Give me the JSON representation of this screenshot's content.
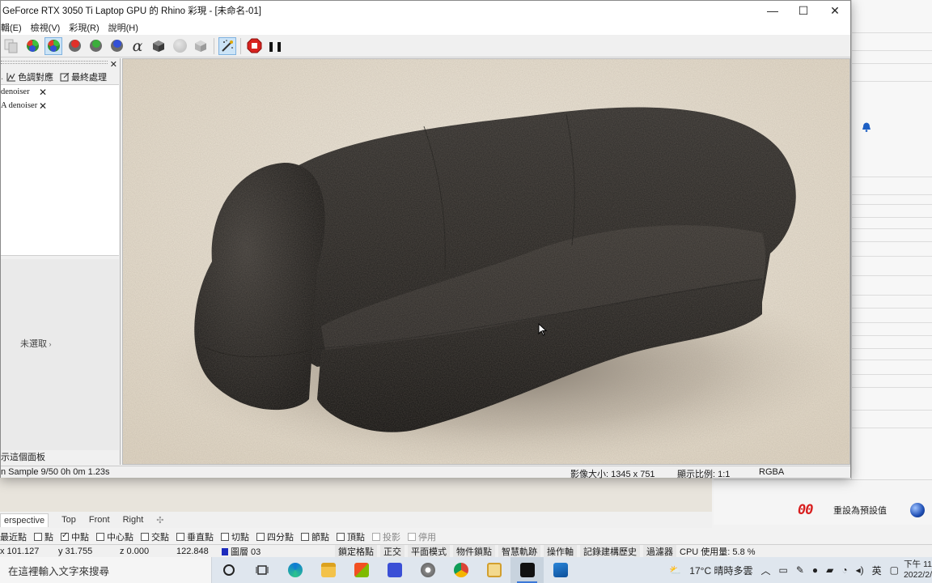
{
  "window": {
    "title": "GeForce RTX 3050 Ti Laptop GPU 的 Rhino 彩現 - [未命名-01]",
    "minimize": "—",
    "maximize": "☐",
    "close": "✕"
  },
  "menu": [
    "輯(E)",
    "檢視(V)",
    "彩現(R)",
    "說明(H)"
  ],
  "toolbar": {
    "icons": [
      "copy-icon",
      "render-channels-icon",
      "render-channels-selected-icon",
      "red-channel-icon",
      "green-channel-icon",
      "blue-channel-icon",
      "alpha-icon",
      "depth-box-icon",
      "sphere-gray-icon",
      "box-gray-icon",
      "post-effects-wand-icon",
      "stop-render-icon",
      "pause-icon"
    ],
    "alpha_glyph": "α",
    "pause_glyph": "❚❚"
  },
  "side_panel": {
    "close": "✕",
    "tabs": [
      {
        "icon": "tone-mapping-icon",
        "label": "色調對應"
      },
      {
        "icon": "post-process-icon",
        "label": "最終處理"
      }
    ],
    "post_items": [
      {
        "label": "denoiser",
        "remove": "✕"
      },
      {
        "label": "A denoiser",
        "remove": "✕"
      }
    ],
    "unselected": "未選取",
    "show_panel": "示這個面板"
  },
  "render_status": {
    "progress": "n Sample 9/50 0h 0m 1.23s",
    "image_size": "影像大小: 1345 x 751",
    "zoom": "顯示比例: 1:1",
    "channel": "RGBA"
  },
  "background_app": {
    "reset_button": "重設為預設值",
    "red_digits": "00",
    "viewport_tabs": [
      "erspective",
      "Top",
      "Front",
      "Right",
      "✣"
    ],
    "osnaps": [
      {
        "label": "最近點",
        "checked": false,
        "bare": true
      },
      {
        "label": "點",
        "checked": false
      },
      {
        "label": "中點",
        "checked": true
      },
      {
        "label": "中心點",
        "checked": false
      },
      {
        "label": "交點",
        "checked": false
      },
      {
        "label": "垂直點",
        "checked": false
      },
      {
        "label": "切點",
        "checked": false
      },
      {
        "label": "四分點",
        "checked": false
      },
      {
        "label": "節點",
        "checked": false
      },
      {
        "label": "頂點",
        "checked": false
      },
      {
        "label": "投影",
        "checked": false,
        "disabled": true
      },
      {
        "label": "停用",
        "checked": false,
        "disabled": true
      }
    ],
    "status": {
      "x": "x 101.127",
      "y": "y 31.755",
      "z": "z 0.000",
      "extra": "122.848",
      "layer": "圖層 03",
      "panes": [
        "鎖定格點",
        "正交",
        "平面模式",
        "物件鎖點",
        "智慧軌跡",
        "操作軸",
        "記錄建構歷史",
        "過濾器"
      ],
      "cpu": "CPU 使用量: 5.8 %"
    }
  },
  "taskbar": {
    "search_placeholder": "在這裡輸入文字來搜尋",
    "apps": [
      "cortana-icon",
      "task-view-icon",
      "edge-icon",
      "file-explorer-icon",
      "store-icon",
      "app-blue-icon",
      "paint-icon",
      "chrome-icon",
      "notes-icon",
      "rhino-icon",
      "photos-icon"
    ],
    "weather": "17°C  晴時多雲",
    "tray_icons": [
      "chevron-up-icon",
      "devices-icon",
      "pen-icon",
      "mic-icon",
      "battery-icon",
      "network-icon",
      "volume-icon"
    ],
    "ime": "英",
    "notification": "▢",
    "clock_time": "下午 11",
    "clock_date": "2022/2/"
  }
}
